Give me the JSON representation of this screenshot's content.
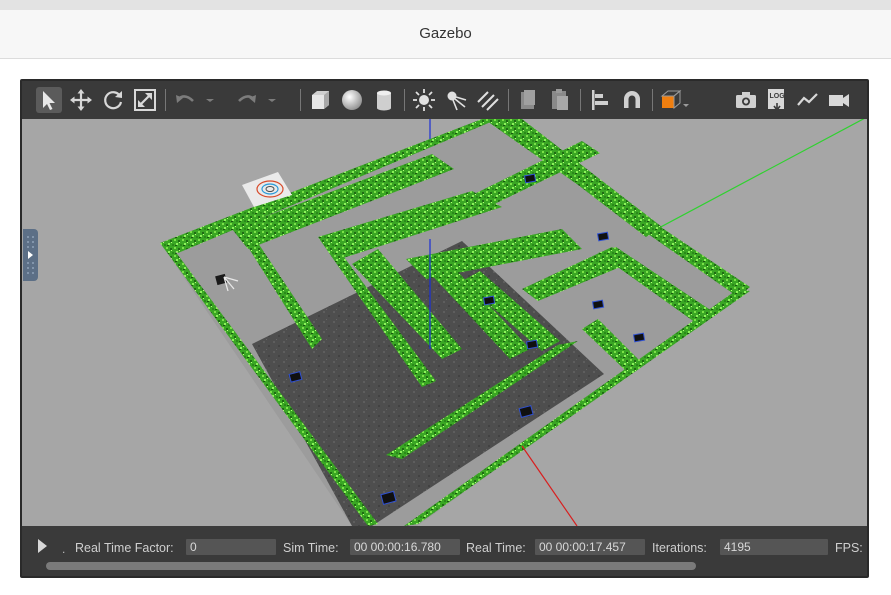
{
  "window": {
    "title": "Gazebo"
  },
  "toolbar": {
    "tools": [
      {
        "name": "select-mode",
        "icon": "arrow-cursor-icon",
        "active": true
      },
      {
        "name": "translate-mode",
        "icon": "move-arrows-icon"
      },
      {
        "name": "rotate-mode",
        "icon": "rotate-icon"
      },
      {
        "name": "scale-mode",
        "icon": "scale-icon"
      },
      {
        "name": "undo",
        "icon": "undo-icon"
      },
      {
        "name": "redo",
        "icon": "redo-icon"
      },
      {
        "name": "box-shape",
        "icon": "box-icon"
      },
      {
        "name": "sphere-shape",
        "icon": "sphere-icon"
      },
      {
        "name": "cylinder-shape",
        "icon": "cylinder-icon"
      },
      {
        "name": "point-light",
        "icon": "sun-icon"
      },
      {
        "name": "spot-light",
        "icon": "spotlight-icon"
      },
      {
        "name": "directional-light",
        "icon": "directional-light-icon"
      },
      {
        "name": "copy",
        "icon": "copy-icon"
      },
      {
        "name": "paste",
        "icon": "paste-icon"
      },
      {
        "name": "align",
        "icon": "align-icon"
      },
      {
        "name": "snap",
        "icon": "magnet-icon"
      },
      {
        "name": "view-angle",
        "icon": "view-cube-icon",
        "accent": "#f07f10"
      },
      {
        "name": "screenshot",
        "icon": "camera-icon"
      },
      {
        "name": "log",
        "icon": "log-icon",
        "text": "LOG"
      },
      {
        "name": "plot",
        "icon": "plot-icon"
      },
      {
        "name": "record-video",
        "icon": "video-camera-icon"
      }
    ]
  },
  "viewport": {
    "ground_color": "#a6a6a6",
    "hedge_color": "#3fb52a",
    "axes": {
      "x": "#d81f1f",
      "y": "#2fd22f",
      "z": "#1a2fd6"
    }
  },
  "status": {
    "real_time_factor_label": "Real Time Factor:",
    "real_time_factor": "0",
    "sim_time_label": "Sim Time:",
    "sim_time": "00 00:00:16.780",
    "real_time_label": "Real Time:",
    "real_time": "00 00:00:17.457",
    "iterations_label": "Iterations:",
    "iterations": "4195",
    "fps_label": "FPS:"
  }
}
